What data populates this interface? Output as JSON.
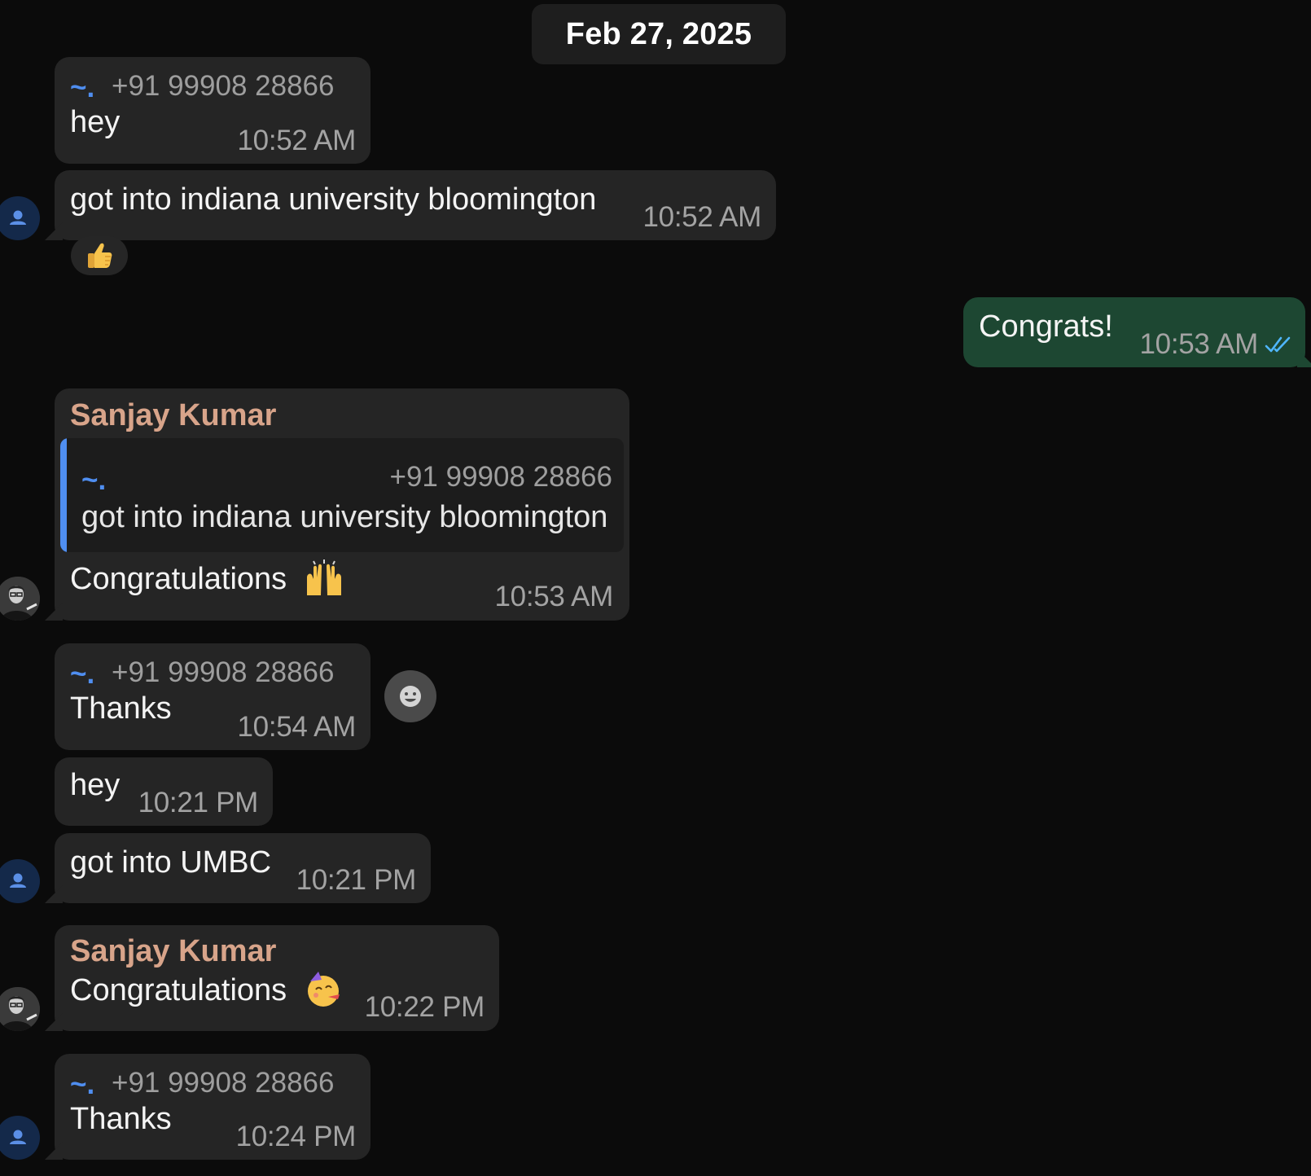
{
  "chat": {
    "date_label": "Feb 27, 2025",
    "messages": [
      {
        "sender_tag": "~.",
        "phone": "+91 99908 28866",
        "text": "hey",
        "time": "10:52 AM"
      },
      {
        "text": "got into indiana university bloomington",
        "time": "10:52 AM",
        "reaction": "thumbs-up-emoji"
      },
      {
        "text": "Congrats!",
        "time": "10:53 AM",
        "direction": "outgoing",
        "status": "read"
      },
      {
        "sender": "Sanjay Kumar",
        "reply_to": {
          "sender_tag": "~.",
          "phone": "+91 99908 28866",
          "text": "got into indiana university bloomington"
        },
        "text": "Congratulations",
        "emoji": "raising-hands-emoji",
        "time": "10:53 AM"
      },
      {
        "sender_tag": "~.",
        "phone": "+91 99908 28866",
        "text": "Thanks",
        "time": "10:54 AM"
      },
      {
        "text": "hey",
        "time": "10:21 PM"
      },
      {
        "text": "got into UMBC",
        "time": "10:21 PM"
      },
      {
        "sender": "Sanjay Kumar",
        "text": "Congratulations",
        "emoji": "partying-face-emoji",
        "time": "10:22 PM"
      },
      {
        "sender_tag": "~.",
        "phone": "+91 99908 28866",
        "text": "Thanks",
        "time": "10:24 PM"
      }
    ]
  },
  "colors": {
    "background": "#0b0b0b",
    "incoming_bubble": "#252525",
    "outgoing_bubble": "#1d4732",
    "sender_name": "#d8a48a",
    "accent_blue": "#4f8ef0",
    "timestamp": "#a3a3a3"
  },
  "icons": [
    "person-avatar-icon",
    "contact-photo-avatar",
    "read-double-check-icon",
    "smiley-react-icon",
    "thumbs-up-emoji",
    "raising-hands-emoji",
    "partying-face-emoji"
  ]
}
